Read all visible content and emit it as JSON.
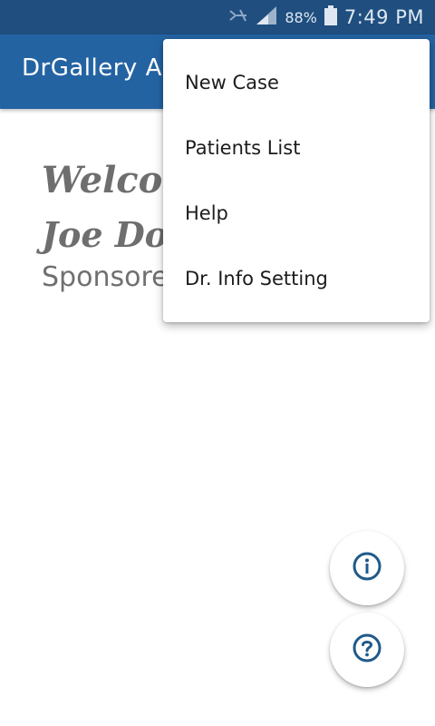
{
  "status_bar": {
    "battery": "88%",
    "time": "7:49 PM",
    "icons": [
      "signal-off-icon",
      "cell-signal-icon",
      "battery-icon"
    ]
  },
  "app_bar": {
    "title": "DrGallery A"
  },
  "content": {
    "welcome": "Welcom",
    "user_name": "Joe Doe",
    "sponsored": "Sponsorec"
  },
  "menu": {
    "items": [
      {
        "label": "New Case"
      },
      {
        "label": "Patients List"
      },
      {
        "label": "Help"
      },
      {
        "label": "Dr. Info Setting"
      }
    ]
  },
  "fabs": [
    {
      "icon": "info-icon"
    },
    {
      "icon": "help-icon"
    }
  ],
  "colors": {
    "status_bar": "#1f4e7f",
    "app_bar": "#2463a2",
    "fab_icon": "#1f5a8a"
  }
}
